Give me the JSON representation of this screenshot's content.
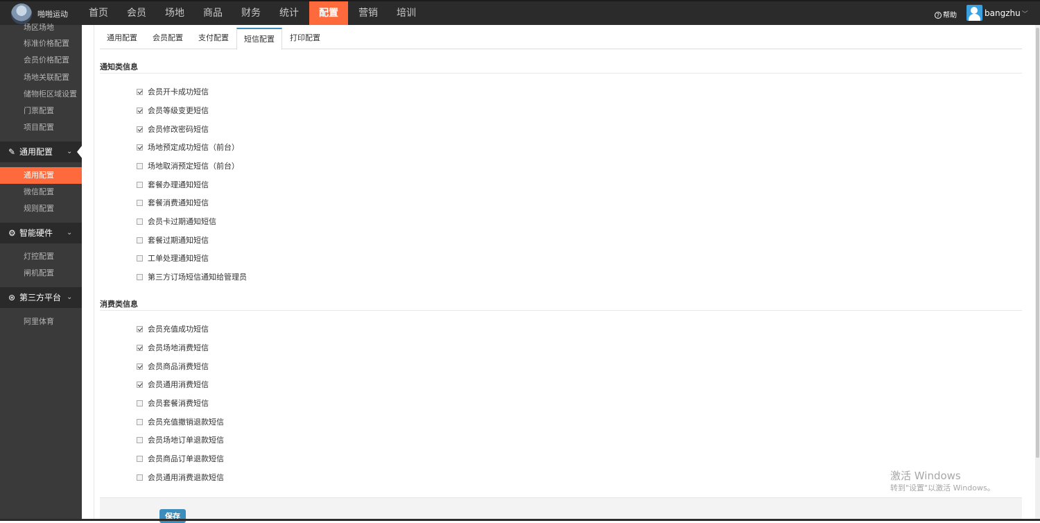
{
  "header": {
    "brand": "啪啪运动",
    "nav": [
      "首页",
      "会员",
      "场地",
      "商品",
      "财务",
      "统计",
      "配置",
      "营销",
      "培训"
    ],
    "help_label": "帮助",
    "username": "bangzhu",
    "user_chevron": "﹀"
  },
  "sidebar": {
    "top_items": [
      "场区场地",
      "标准价格配置",
      "会员价格配置",
      "场地关联配置",
      "储物柜区域设置",
      "门票配置",
      "项目配置"
    ],
    "groups": [
      {
        "icon": "wrench-icon",
        "glyph": "✎",
        "label": "通用配置",
        "chev": "⌄",
        "items": [
          "通用配置",
          "微信配置",
          "规则配置"
        ]
      },
      {
        "icon": "gear-icon",
        "glyph": "⚙",
        "label": "智能硬件",
        "chev": "⌄",
        "items": [
          "灯控配置",
          "闸机配置"
        ]
      },
      {
        "icon": "handshake-icon",
        "glyph": "⊛",
        "label": "第三方平台",
        "chev": "⌄",
        "items": [
          "阿里体育"
        ]
      }
    ]
  },
  "tabs": [
    "通用配置",
    "会员配置",
    "支付配置",
    "短信配置",
    "打印配置"
  ],
  "sections": [
    {
      "title": "通知类信息",
      "items": [
        {
          "label": "会员开卡成功短信",
          "checked": true
        },
        {
          "label": "会员等级变更短信",
          "checked": true
        },
        {
          "label": "会员修改密码短信",
          "checked": true
        },
        {
          "label": "场地预定成功短信（前台）",
          "checked": true
        },
        {
          "label": "场地取消预定短信（前台）",
          "checked": false
        },
        {
          "label": "套餐办理通知短信",
          "checked": false
        },
        {
          "label": "套餐消费通知短信",
          "checked": false
        },
        {
          "label": "会员卡过期通知短信",
          "checked": false
        },
        {
          "label": "套餐过期通知短信",
          "checked": false
        },
        {
          "label": "工单处理通知短信",
          "checked": false
        },
        {
          "label": "第三方订场短信通知给管理员",
          "checked": false
        }
      ]
    },
    {
      "title": "消费类信息",
      "items": [
        {
          "label": "会员充值成功短信",
          "checked": true
        },
        {
          "label": "会员场地消费短信",
          "checked": true
        },
        {
          "label": "会员商品消费短信",
          "checked": true
        },
        {
          "label": "会员通用消费短信",
          "checked": true
        },
        {
          "label": "会员套餐消费短信",
          "checked": false
        },
        {
          "label": "会员充值撤销退款短信",
          "checked": false
        },
        {
          "label": "会员场地订单退款短信",
          "checked": false
        },
        {
          "label": "会员商品订单退款短信",
          "checked": false
        },
        {
          "label": "会员通用消费退款短信",
          "checked": false
        }
      ]
    }
  ],
  "save_label": "保存",
  "watermark": {
    "title": "激活 Windows",
    "subtitle": "转到\"设置\"以激活 Windows。"
  }
}
